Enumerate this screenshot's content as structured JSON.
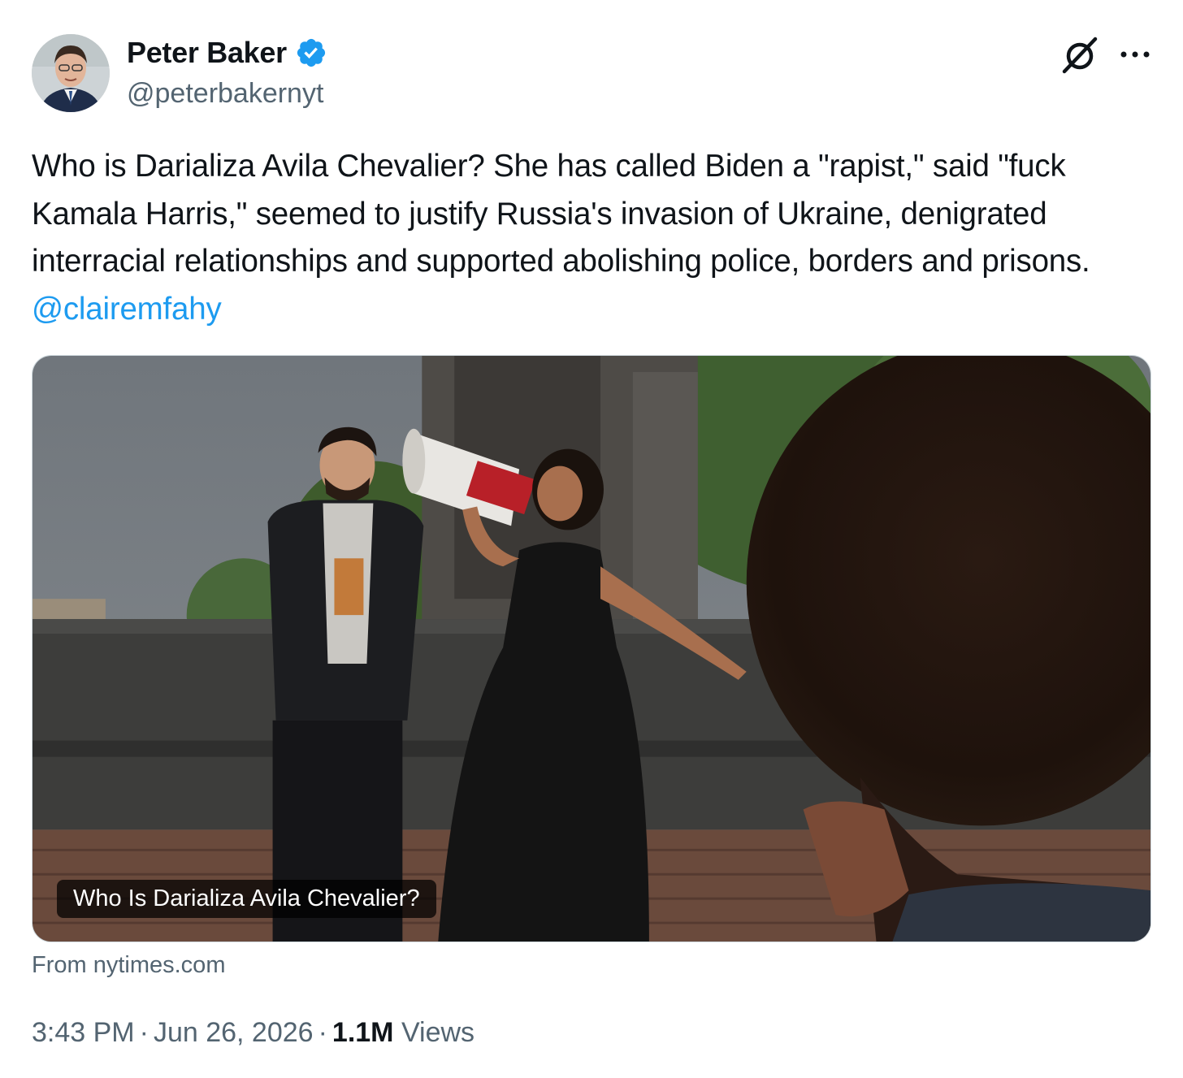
{
  "author": {
    "display_name": "Peter Baker",
    "handle": "@peterbakernyt",
    "verified": true,
    "avatar_icon": "author-avatar"
  },
  "header_actions": {
    "grok_icon": "grok-icon",
    "more_icon": "more-icon"
  },
  "tweet": {
    "text": "Who is Darializa Avila Chevalier? She has called Biden a \"rapist,\" said \"fuck Kamala Harris,\" seemed to justify Russia's invasion of Ukraine, denigrated interracial relationships and supported abolishing police, borders and prisons. ",
    "mention": "@clairemfahy"
  },
  "card": {
    "caption": "Who Is Darializa Avila Chevalier?",
    "source": "From nytimes.com"
  },
  "meta": {
    "time": "3:43 PM",
    "date": "Jun 26, 2026",
    "views_count": "1.1M",
    "views_label": "Views",
    "separator": "·"
  },
  "colors": {
    "text": "#0f1419",
    "secondary": "#536471",
    "link": "#1d9bf0",
    "verified_badge": "#1d9bf0"
  }
}
